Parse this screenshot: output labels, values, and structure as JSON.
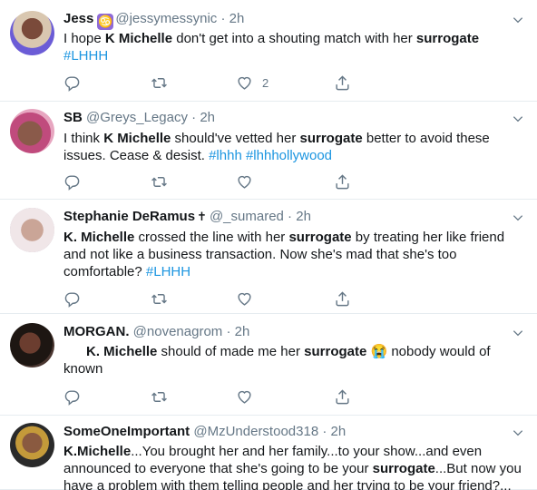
{
  "tweets": [
    {
      "name": "Jess",
      "badge": "♋",
      "handle": "@jessymessynic",
      "time": "2h",
      "parts": [
        {
          "t": "I hope "
        },
        {
          "t": "K Michelle",
          "b": true
        },
        {
          "t": " don't get into a shouting match with her "
        },
        {
          "t": "surrogate",
          "b": true
        },
        {
          "t": " "
        },
        {
          "t": "#LHHH",
          "h": true
        }
      ],
      "actions": {
        "reply": "",
        "retweet": "",
        "like": "2",
        "share": ""
      }
    },
    {
      "name": "SB",
      "handle": "@Greys_Legacy",
      "time": "2h",
      "parts": [
        {
          "t": "I think "
        },
        {
          "t": "K Michelle",
          "b": true
        },
        {
          "t": " should've vetted her "
        },
        {
          "t": "surrogate",
          "b": true
        },
        {
          "t": " better to avoid these issues. Cease & desist. "
        },
        {
          "t": "#lhhh",
          "h": true
        },
        {
          "t": " "
        },
        {
          "t": "#lhhhollywood",
          "h": true
        }
      ],
      "actions": {
        "reply": "",
        "retweet": "",
        "like": "",
        "share": ""
      }
    },
    {
      "name": "Stephanie DeRamus",
      "extra": "✝",
      "handle": "@_sumared",
      "time": "2h",
      "parts": [
        {
          "t": "K. Michelle",
          "b": true
        },
        {
          "t": " crossed the line with her "
        },
        {
          "t": "surrogate",
          "b": true
        },
        {
          "t": " by treating her like friend and not like a business transaction. Now she's mad that she's too comfortable? "
        },
        {
          "t": "#LHHH",
          "h": true
        }
      ],
      "actions": {
        "reply": "",
        "retweet": "",
        "like": "",
        "share": ""
      }
    },
    {
      "name": "MORGAN.",
      "handle": "@novenagrom",
      "time": "2h",
      "parts": [
        {
          "t": "      "
        },
        {
          "t": "K. Michelle",
          "b": true
        },
        {
          "t": " should of made me her "
        },
        {
          "t": "surrogate",
          "b": true
        },
        {
          "t": " 😭 nobody would of known"
        }
      ],
      "actions": {
        "reply": "",
        "retweet": "",
        "like": "",
        "share": ""
      }
    },
    {
      "name": "SomeOneImportant",
      "handle": "@MzUnderstood318",
      "time": "2h",
      "parts": [
        {
          "t": "K.Michelle",
          "b": true
        },
        {
          "t": "...You brought her and her family...to your show...and even announced to everyone that she's going to be your "
        },
        {
          "t": "surrogate",
          "b": true
        },
        {
          "t": "...But now you have a problem with them telling people and her trying to be your friend?..."
        }
      ],
      "actions": {
        "reply": "",
        "retweet": "",
        "like": "",
        "share": ""
      }
    }
  ],
  "colors": {
    "link": "#1b95e0",
    "muted": "#657786",
    "text": "#14171a",
    "divider": "#e6ecf0"
  },
  "icons": {
    "reply": "reply-icon",
    "retweet": "retweet-icon",
    "like": "heart-icon",
    "share": "share-icon",
    "menu": "chevron-down-icon"
  }
}
